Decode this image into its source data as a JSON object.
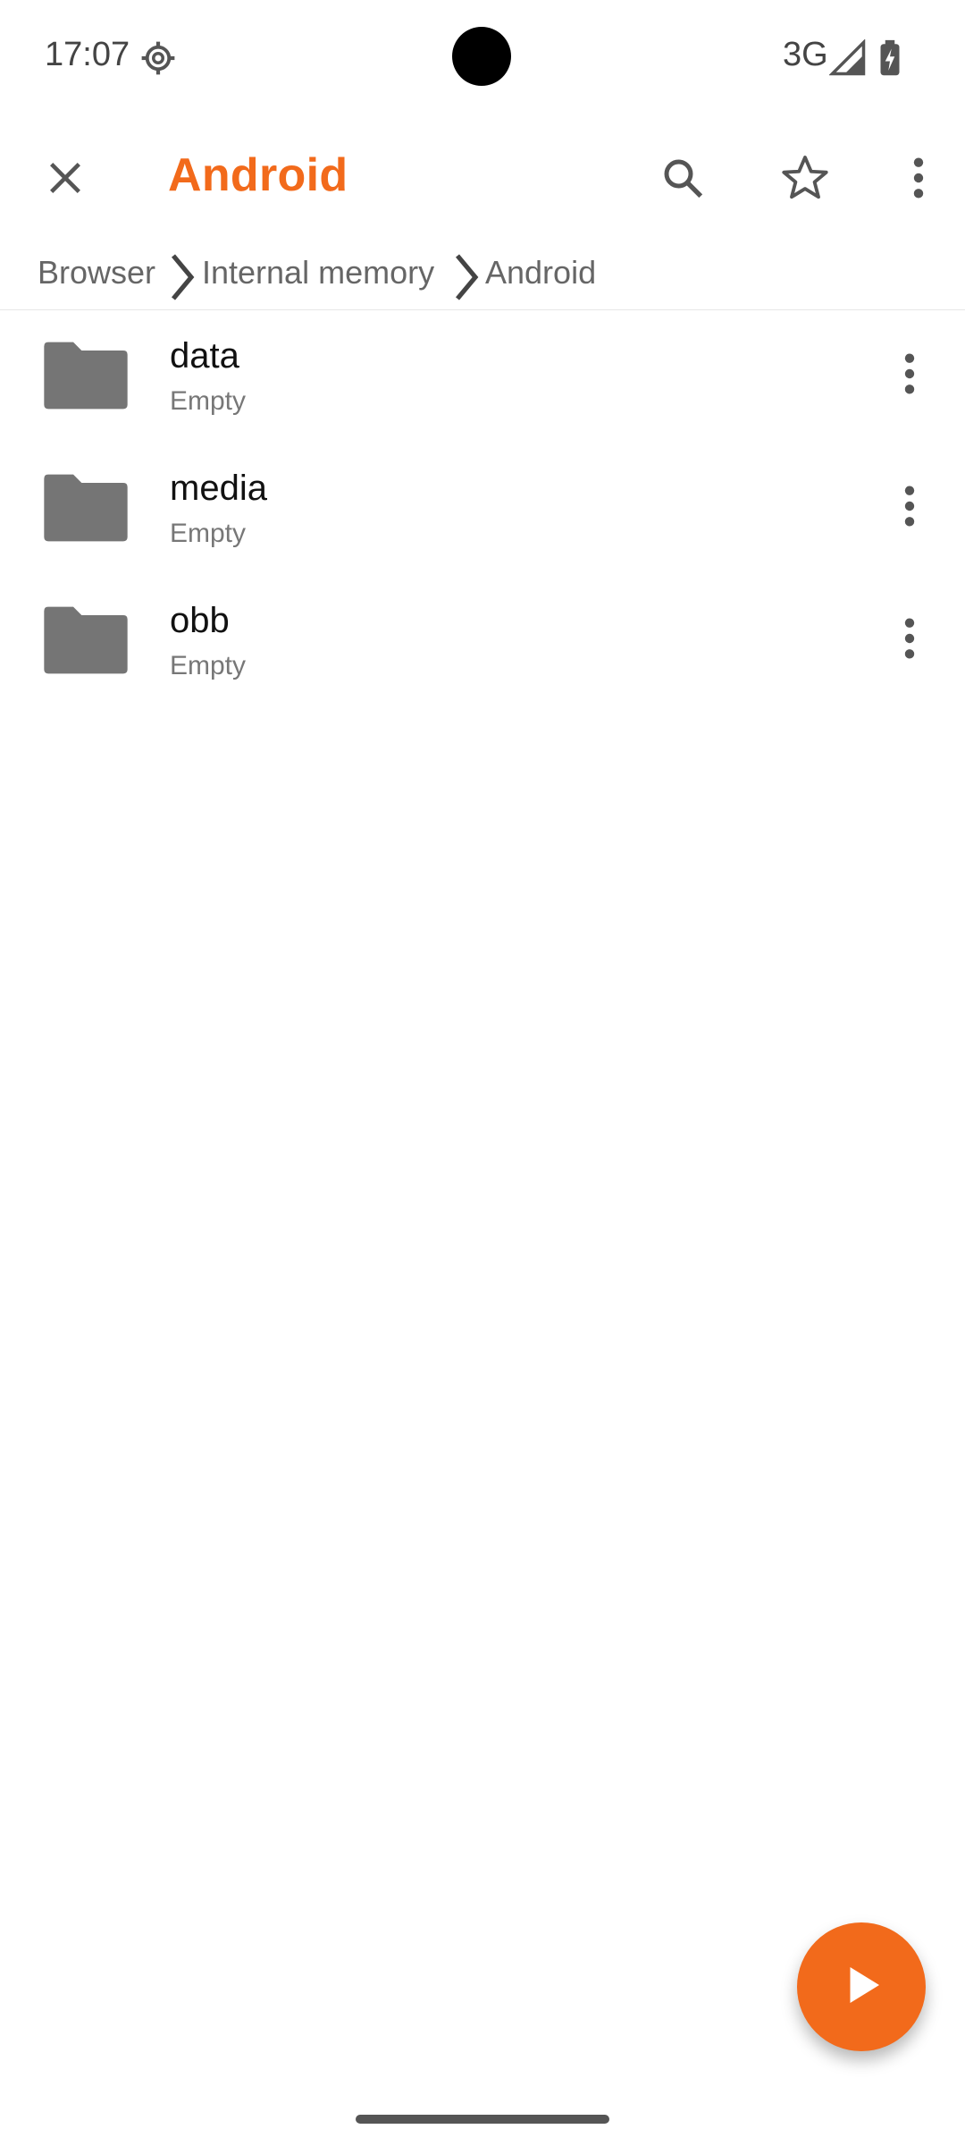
{
  "status_bar": {
    "time": "17:07",
    "network": "3G",
    "icons": [
      "settings-gear-icon",
      "signal-icon",
      "battery-icon"
    ]
  },
  "toolbar": {
    "title": "Android",
    "icons": [
      "close-icon",
      "search-icon",
      "star-icon",
      "more-vert-icon"
    ],
    "accent_color": "#f26a1b"
  },
  "breadcrumb": {
    "items": [
      "Browser",
      "Internal memory",
      "Android"
    ]
  },
  "files": [
    {
      "name": "data",
      "subtitle": "Empty",
      "icon": "folder-icon"
    },
    {
      "name": "media",
      "subtitle": "Empty",
      "icon": "folder-icon"
    },
    {
      "name": "obb",
      "subtitle": "Empty",
      "icon": "folder-icon"
    }
  ],
  "fab": {
    "icon": "play-icon",
    "color": "#f26a1b"
  }
}
